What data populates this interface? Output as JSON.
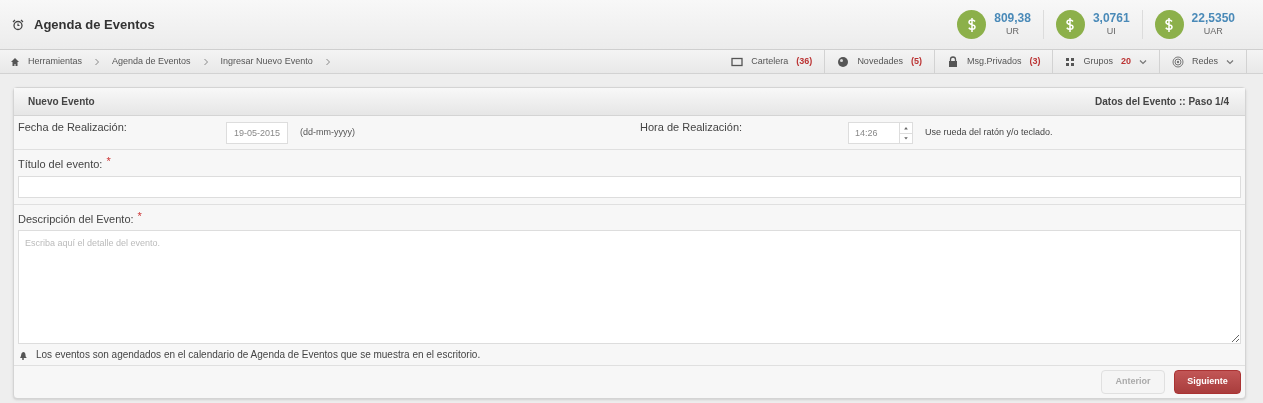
{
  "header": {
    "title": "Agenda de Eventos",
    "rates": [
      {
        "value": "809,38",
        "unit": "UR"
      },
      {
        "value": "3,0761",
        "unit": "UI"
      },
      {
        "value": "22,5350",
        "unit": "UAR"
      }
    ]
  },
  "breadcrumb": [
    "Herramientas",
    "Agenda de Eventos",
    "Ingresar Nuevo Evento"
  ],
  "nav": [
    {
      "kind": "board",
      "label": "Cartelera",
      "count": "(36)",
      "dropdown": false
    },
    {
      "kind": "news",
      "label": "Novedades",
      "count": "(5)",
      "dropdown": false
    },
    {
      "kind": "lock",
      "label": "Msg.Privados",
      "count": "(3)",
      "dropdown": false
    },
    {
      "kind": "groups",
      "label": "Grupos",
      "count": "20",
      "dropdown": true
    },
    {
      "kind": "networks",
      "label": "Redes",
      "dropdown": true
    }
  ],
  "panel": {
    "title": "Nuevo Evento",
    "step": "Datos del Evento :: Paso 1/4",
    "date": {
      "label": "Fecha de Realización:",
      "value": "19-05-2015",
      "hint": "(dd-mm-yyyy)"
    },
    "time": {
      "label": "Hora de Realización:",
      "value": "14:26",
      "hint": "Use rueda del ratón y/o teclado."
    },
    "title_field": {
      "label": "Título del evento:",
      "required_mark": "*"
    },
    "description": {
      "label": "Descripción del Evento:",
      "required_mark": "*",
      "placeholder": "Escriba aquí el detalle del evento."
    },
    "note": "Los eventos son agendados en el calendario de Agenda de Eventos que se muestra en el escritorio.",
    "buttons": [
      {
        "label": "Anterior",
        "disabled": true
      },
      {
        "label": "Siguiente",
        "disabled": false
      }
    ]
  }
}
